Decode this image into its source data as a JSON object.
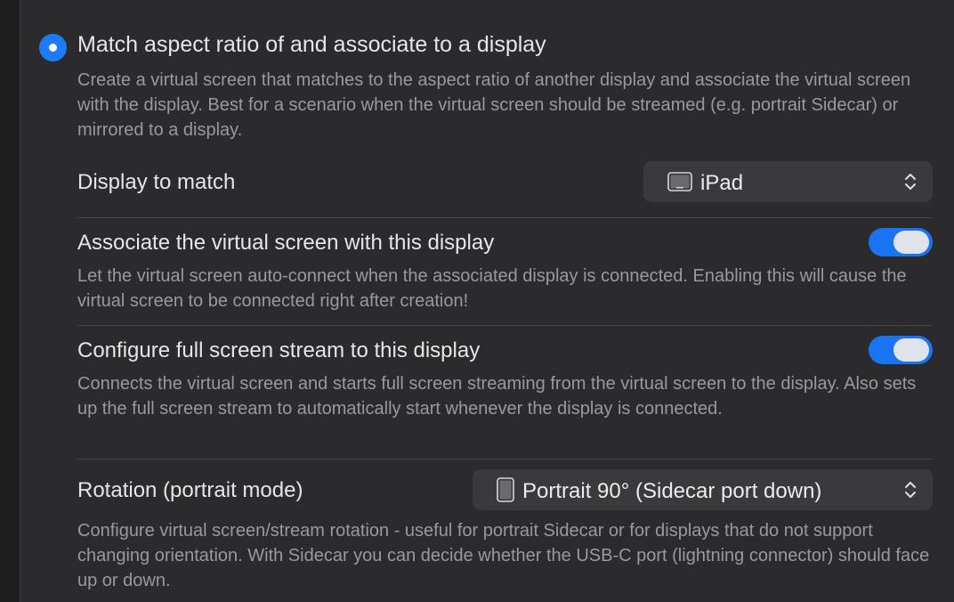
{
  "option": {
    "title": "Match aspect ratio of and associate to a display",
    "selected": true,
    "description": "Create a virtual screen that matches to the aspect ratio of another display and associate the virtual screen with the display. Best for a scenario when the virtual screen should be streamed (e.g. portrait Sidecar) or mirrored to a display."
  },
  "display_to_match": {
    "label": "Display to match",
    "value": "iPad",
    "icon": "ipad-icon"
  },
  "associate": {
    "label": "Associate the virtual screen with this display",
    "enabled": true,
    "description": "Let the virtual screen auto-connect when the associated display is connected. Enabling this will cause the virtual screen to be connected right after creation!"
  },
  "full_screen_stream": {
    "label": "Configure full screen stream to this display",
    "enabled": true,
    "description": "Connects the virtual screen and starts full screen streaming from the virtual screen to the display. Also sets up the full screen stream to automatically start whenever the display is connected."
  },
  "rotation": {
    "label": "Rotation (portrait mode)",
    "value": "Portrait 90° (Sidecar port down)",
    "icon": "iphone-portrait-icon",
    "description": "Configure virtual screen/stream rotation - useful for portrait Sidecar or for displays that do not support changing orientation. With Sidecar you can decide whether the USB-C port (lightning connector) should face up or down."
  },
  "colors": {
    "accent": "#1d7bf6",
    "background": "#2b2a2c",
    "control": "#3a393b"
  }
}
